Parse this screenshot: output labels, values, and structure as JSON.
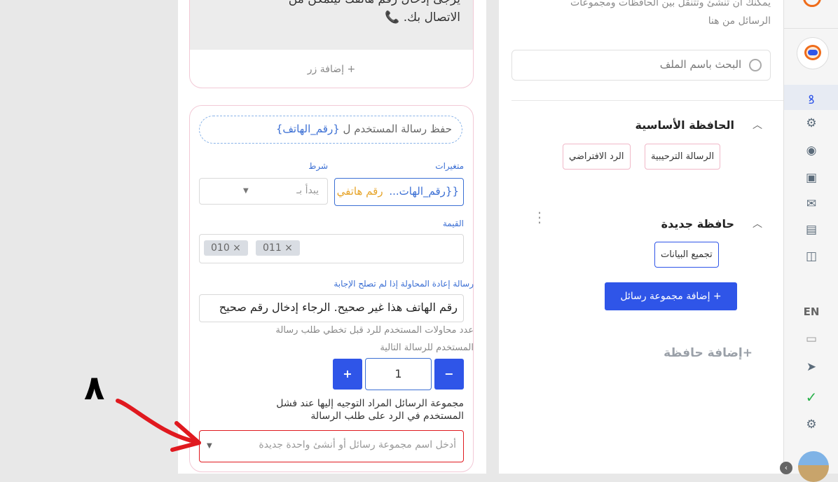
{
  "editor": {
    "top_text_line1": "يرجى إدخال رقم هاتفك ليتمكن من",
    "top_text_line2": "الاتصال بك.",
    "phone_emoji": "📞",
    "add_button_label": "+ إضافة زر",
    "save_pill_text": "حفظ رسالة المستخدم ل",
    "save_pill_var": "{رقم_الهاتف}",
    "variables_label": "متغيرات",
    "condition_label": "شرط",
    "variable_chip": "{{رقم_الهات...",
    "variable_name": "رقم هاتفي",
    "condition_value": "يبدأ بـ",
    "value_label": "القيمة",
    "value_chips": [
      "011 ×",
      "010 ×"
    ],
    "retry_label": "رسالة إعادة المحاولة إذا لم تصلح الإجابة",
    "retry_value": "رقم الهاتف هذا غير صحيح. الرجاء إدخال رقم صحيح",
    "attempts_label_line1": "عدد محاولات المستخدم للرد قبل تخطي طلب رسالة",
    "attempts_label_line2": "المستخدم للرسالة التالية",
    "stepper_value": "1",
    "stepper_plus": "+",
    "stepper_minus": "−",
    "redirect_label_line1": "مجموعة الرسائل المراد التوجيه إليها عند فشل",
    "redirect_label_line2": "المستخدم في الرد على طلب الرسالة",
    "redirect_placeholder": "أدخل اسم مجموعة رسائل أو أنشئ واحدة جديدة",
    "annotation_number": "٨"
  },
  "folders": {
    "intro_line1": "يمكنك أن تنشئ وتتنقل بين الحافظات ومجموعات",
    "intro_line2": "الرسائل من هنا",
    "search_placeholder": "البحث باسم الملف",
    "main_folder_title": "الحافظة الأساسية",
    "main_folder_items": [
      "الرسالة الترحيبية",
      "الرد الافتراضي"
    ],
    "new_folder_title": "حافظة جديدة",
    "new_folder_items": [
      "تجميع البيانات"
    ],
    "add_group_label": "+ إضافة مجموعة رسائل",
    "add_folder_label": "+إضافة حافظة"
  },
  "sidebar": {
    "lang": "EN"
  },
  "colors": {
    "accent": "#2f55e8",
    "brand_orange": "#ef6c1a",
    "error_red": "#e0191f",
    "check_green": "#2bb24c"
  }
}
